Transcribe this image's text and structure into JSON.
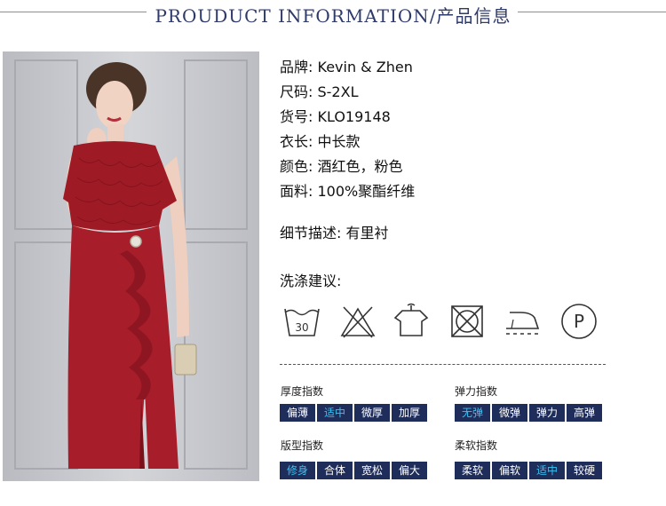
{
  "header": {
    "title": "PROUDUCT INFORMATION/产品信息"
  },
  "colors": {
    "accent_dark": "#1f2d5a",
    "active_text": "#35c4f5",
    "dress_red": "#a71d2a"
  },
  "specs": [
    {
      "key": "品牌:",
      "value": "Kevin & Zhen"
    },
    {
      "key": "尺码:",
      "value": "S-2XL"
    },
    {
      "key": "货号:",
      "value": "KLO19148"
    },
    {
      "key": "衣长:",
      "value": "中长款"
    },
    {
      "key": "颜色:",
      "value": "酒红色，粉色"
    },
    {
      "key": "面料:",
      "value": "100%聚酯纤维"
    }
  ],
  "detail": {
    "key": "细节描述:",
    "value": "有里衬"
  },
  "care": {
    "title": "洗涤建议:",
    "icons": [
      "wash-30-icon",
      "no-bleach-icon",
      "hang-dry-icon",
      "no-tumble-dry-icon",
      "iron-low-icon",
      "dry-clean-p-icon"
    ],
    "wash_temp": "30",
    "dryclean_letter": "P"
  },
  "indices": [
    {
      "title": "厚度指数",
      "options": [
        "偏薄",
        "适中",
        "微厚",
        "加厚"
      ],
      "active": 1
    },
    {
      "title": "弹力指数",
      "options": [
        "无弹",
        "微弹",
        "弹力",
        "高弹"
      ],
      "active": 0
    },
    {
      "title": "版型指数",
      "options": [
        "修身",
        "合体",
        "宽松",
        "偏大"
      ],
      "active": 0
    },
    {
      "title": "柔软指数",
      "options": [
        "柔软",
        "偏软",
        "适中",
        "较硬"
      ],
      "active": 2
    }
  ]
}
